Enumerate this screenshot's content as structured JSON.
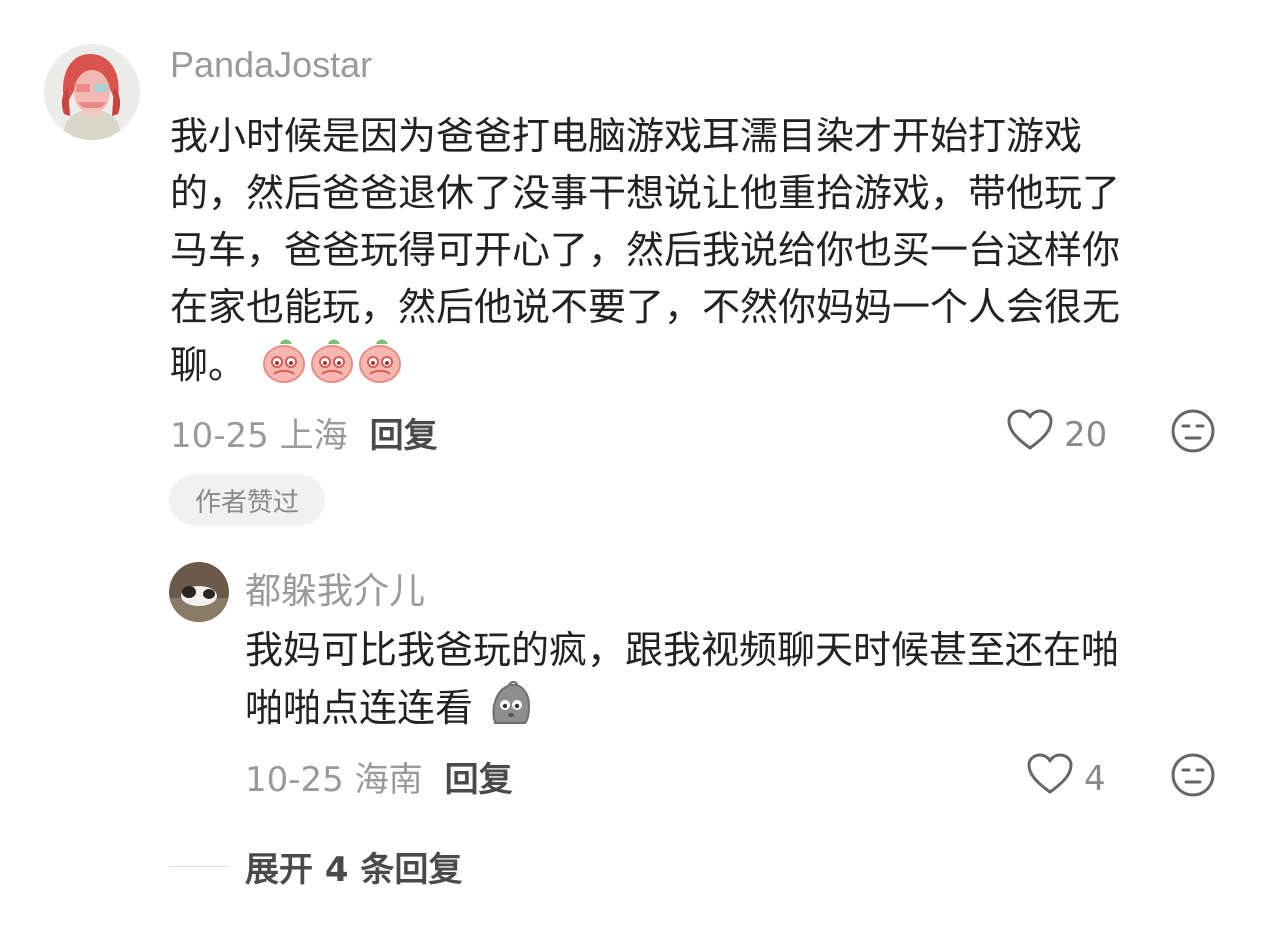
{
  "comment": {
    "username": "PandaJostar",
    "text_lines": [
      "我小时候是因为爸爸打电脑游戏耳濡目染才开始打游戏",
      "的，然后爸爸退休了没事干想说让他重拾游戏，带他玩了",
      "马车，爸爸玩得可开心了，然后我说给你也买一台这样你",
      "在家也能玩，然后他说不要了，不然你妈妈一个人会很无",
      "聊。"
    ],
    "emoji": "peach-pleading-emoji",
    "date_location": "10-25 上海",
    "reply_label": "回复",
    "like_count": "20",
    "badge": "作者赞过"
  },
  "reply": {
    "username": "都躲我介儿",
    "text_lines": [
      "我妈可比我爸玩的疯，跟我视频聊天时候甚至还在啪",
      "啪啪点连连看"
    ],
    "emoji": "grey-blob-emoji",
    "date_location": "10-25 海南",
    "reply_label": "回复",
    "like_count": "4"
  },
  "expand": {
    "label": "展开 4 条回复"
  },
  "colors": {
    "text": "#222222",
    "muted": "#9a9a9a",
    "badge_bg": "#f1f1f1"
  }
}
